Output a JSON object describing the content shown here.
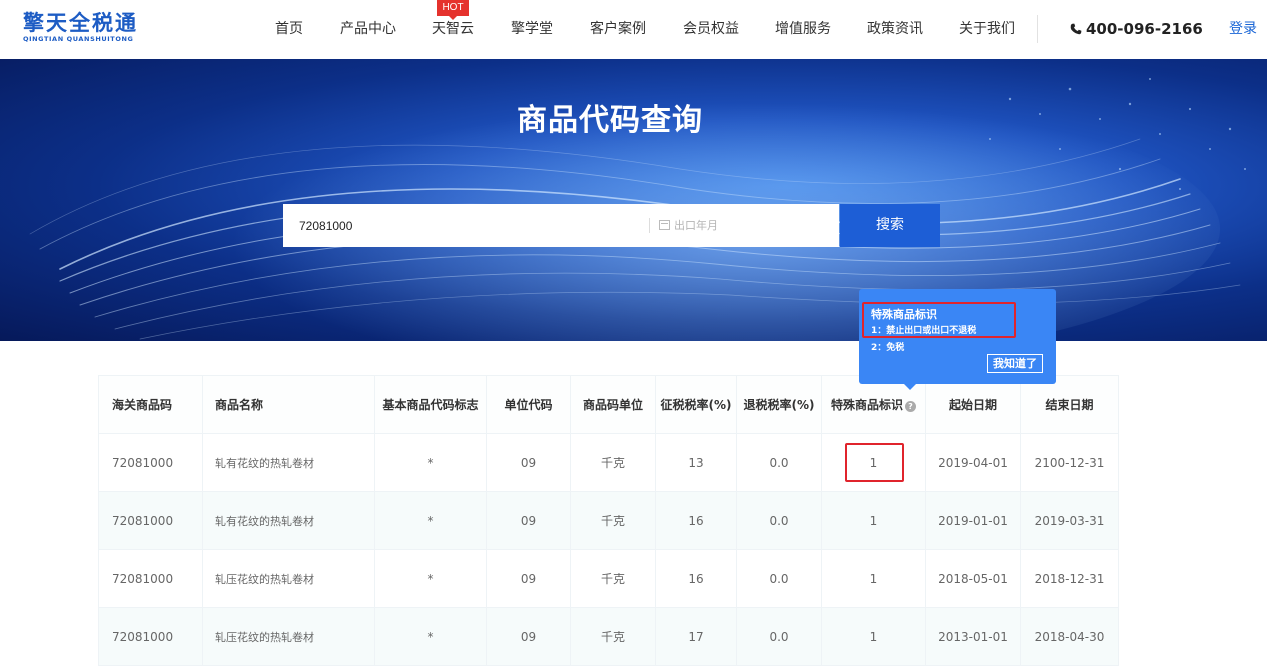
{
  "brand": {
    "name": "擎天全税通",
    "subtitle": "QINGTIAN QUANSHUITONG"
  },
  "nav": {
    "items": [
      "首页",
      "产品中心",
      "天智云",
      "擎学堂",
      "客户案例",
      "会员权益",
      "增值服务",
      "政策资讯",
      "关于我们"
    ],
    "hot_badge": "HOT",
    "phone": "400-096-2166",
    "login": "登录"
  },
  "banner": {
    "title": "商品代码查询",
    "search_value": "72081000",
    "date_placeholder": "出口年月",
    "search_button": "搜索"
  },
  "tooltip": {
    "title": "特殊商品标识",
    "line1": "1：禁止出口或出口不退税",
    "line2": "2：免税",
    "confirm": "我知道了"
  },
  "table": {
    "headers": [
      "海关商品码",
      "商品名称",
      "基本商品代码标志",
      "单位代码",
      "商品码单位",
      "征税税率(%)",
      "退税税率(%)",
      "特殊商品标识",
      "起始日期",
      "结束日期"
    ],
    "rows": [
      [
        "72081000",
        "轧有花纹的热轧卷材",
        "*",
        "09",
        "千克",
        "13",
        "0.0",
        "1",
        "2019-04-01",
        "2100-12-31"
      ],
      [
        "72081000",
        "轧有花纹的热轧卷材",
        "*",
        "09",
        "千克",
        "16",
        "0.0",
        "1",
        "2019-01-01",
        "2019-03-31"
      ],
      [
        "72081000",
        "轧压花纹的热轧卷材",
        "*",
        "09",
        "千克",
        "16",
        "0.0",
        "1",
        "2018-05-01",
        "2018-12-31"
      ],
      [
        "72081000",
        "轧压花纹的热轧卷材",
        "*",
        "09",
        "千克",
        "17",
        "0.0",
        "1",
        "2013-01-01",
        "2018-04-30"
      ]
    ]
  },
  "colors": {
    "brand": "#1d5cc4",
    "primary": "#1d5ed6",
    "tooltip": "#3a86f5",
    "highlight": "#e0242c",
    "hot": "#e5322d"
  }
}
